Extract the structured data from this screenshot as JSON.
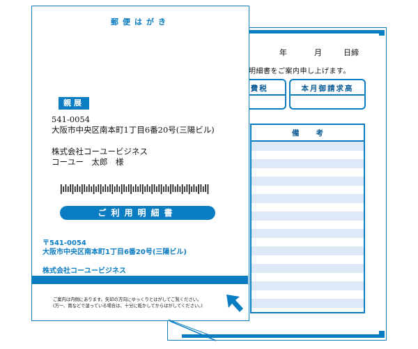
{
  "postcard": {
    "title": "郵便はがき",
    "recipient_badge": "親展",
    "postal_code": "541-0054",
    "address": "大阪市中央区南本町1丁目6番20号(三陽ビル)",
    "company": "株式会社コーユービジネス",
    "person": "コーユー　太郎　様",
    "banner": "ご利用明細書",
    "sender_postal": "〒541-0054",
    "sender_address": "大阪市中央区南本町1丁目6番20号(三陽ビル)",
    "sender_company": "株式会社コーユービジネス",
    "note_line1": "ご案内は内側にあります。矢印の方向にゆっくりとはがしてご覧ください。",
    "note_line2": "(万一、雨などで湿っている場合は、十分に乾かしてからはがしてください。)",
    "arrow_icon": "diagonal-arrow-icon"
  },
  "statement": {
    "date_year": "年",
    "date_month": "月",
    "date_day": "日締",
    "intro": "明細書をご案内申し上げます。",
    "tax_label": "消費税",
    "total_label": "本月御請求高",
    "remarks_label_1": "備",
    "remarks_label_2": "考"
  },
  "colors": {
    "accent": "#0a7cc1",
    "stripe": "#dde9f6"
  }
}
